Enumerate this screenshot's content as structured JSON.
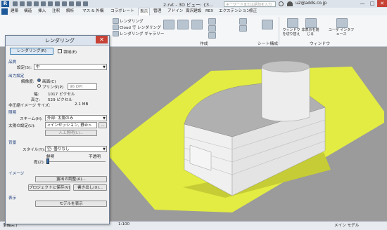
{
  "app": {
    "logo_letter": "R",
    "title": "2.rvt - 3D ビュー: {3...",
    "search_placeholder": "キーワードまたは語句を入力",
    "user": "u2@adds.co.jp",
    "min": "—",
    "max": "□",
    "close": "✕"
  },
  "menu_tabs": [
    "建築",
    "構造",
    "挿入",
    "注釈",
    "解析",
    "マス & 外構",
    "コラボレート",
    "表示",
    "管理",
    "アドイン",
    "嵩沢建設",
    "REX",
    "エクステンション",
    "修正"
  ],
  "active_tab": "表示",
  "ribbon": {
    "render_items": [
      "レンダリング",
      "Cloud で レンダリング",
      "レンダリング ギャラリー"
    ],
    "groups": [
      "作成",
      "シート構成",
      "ウィンドウ"
    ],
    "window_buttons": [
      "ウィンドウを切り替え",
      "非表示を閉じる",
      "ユーザ インタフェース"
    ]
  },
  "dialog": {
    "title": "レンダリング",
    "close": "✕",
    "render_button": "レンダリング(R)",
    "region_label": "領域(E)",
    "quality_section": "品質",
    "setting_label": "設定(S):",
    "setting_value": "中",
    "output_section": "出力設定",
    "resolution_label": "解像度:",
    "screen_option": "画面(C)",
    "printer_option": "プリンタ(P)",
    "dpi_value": "96 DPI",
    "width_label": "幅:",
    "width_value": "1017 ピクセル",
    "height_label": "高さ:",
    "height_value": "529 ピクセル",
    "size_label": "非圧縮イメージ サイズ:",
    "size_value": "2.1 MB",
    "lighting_section": "照明",
    "scheme_label": "スキーム(H):",
    "scheme_value": "外部: 太陽のみ",
    "sun_label": "太陽の設定(U):",
    "sun_value": "<インセッション, 静止>",
    "artificial_button": "人工照明(L)...",
    "background_section": "背景",
    "style_label": "スタイル(Y):",
    "style_value": "空: 曇りなし",
    "clear_label": "鮮明",
    "haze_label": "霞(Z):",
    "opaque_label": "不透明",
    "image_section": "イメージ",
    "exposure_button": "露出の調整(A)...",
    "save_project_button": "プロジェクトに保存(V)...",
    "export_button": "書き出し(X)...",
    "display_section": "表示",
    "show_model_button": "モデルを表示"
  },
  "status": {
    "left": "準備完了",
    "scale": "1:100",
    "model": "メイン モデル"
  },
  "colors": {
    "ground": "#e2ec42",
    "walls": "#f0f0f0",
    "roof": "#b0b0b0",
    "viewport_bg": "#9b9b9b"
  }
}
